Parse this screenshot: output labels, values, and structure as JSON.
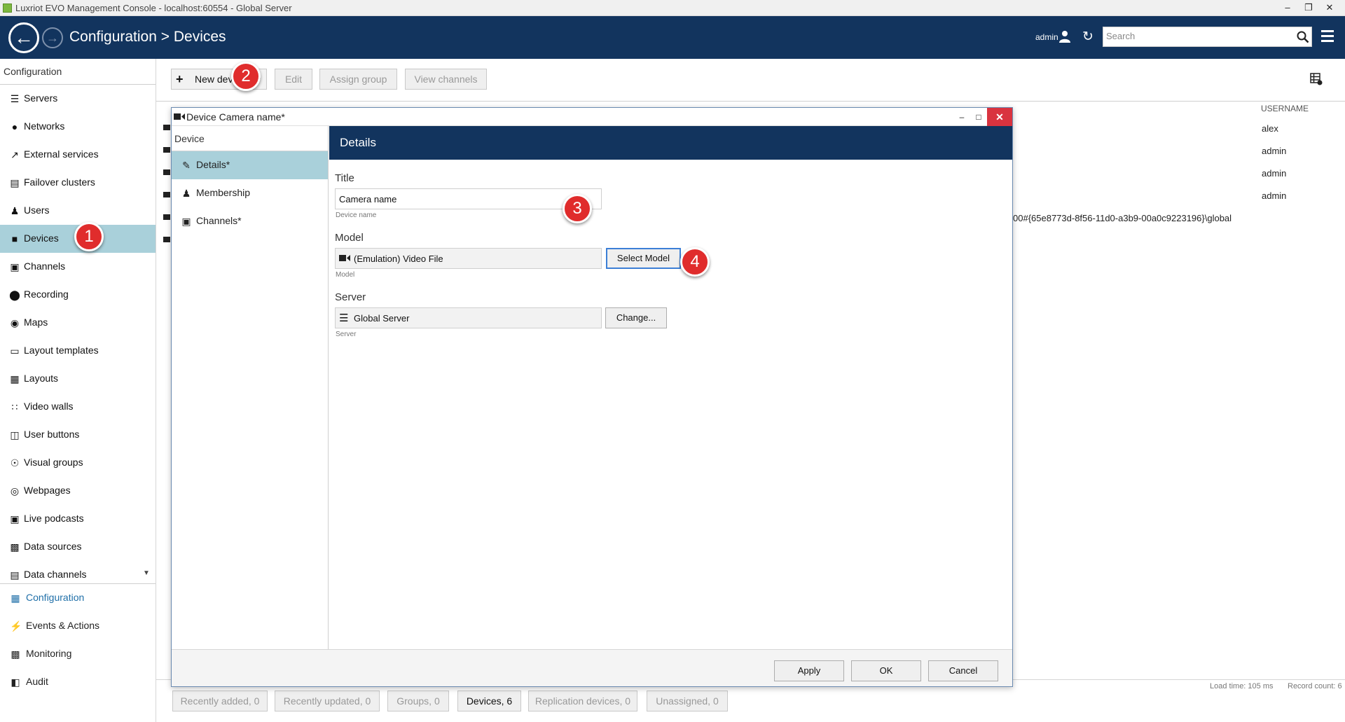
{
  "window": {
    "title": "Luxriot EVO Management Console - localhost:60554 - Global Server",
    "controls": [
      "minimize",
      "restore",
      "close"
    ]
  },
  "header": {
    "breadcrumb": "Configuration > Devices",
    "user": "admin",
    "search_placeholder": "Search"
  },
  "sidebar": {
    "section_title": "Configuration",
    "items": [
      {
        "label": "Servers",
        "icon": "servers-icon"
      },
      {
        "label": "Networks",
        "icon": "globe-icon"
      },
      {
        "label": "External services",
        "icon": "external-icon"
      },
      {
        "label": "Failover clusters",
        "icon": "cluster-icon"
      },
      {
        "label": "Users",
        "icon": "user-icon"
      },
      {
        "label": "Devices",
        "icon": "camera-icon"
      },
      {
        "label": "Channels",
        "icon": "channels-icon"
      },
      {
        "label": "Recording",
        "icon": "record-icon"
      },
      {
        "label": "Maps",
        "icon": "map-icon"
      },
      {
        "label": "Layout templates",
        "icon": "layout-template-icon"
      },
      {
        "label": "Layouts",
        "icon": "layouts-icon"
      },
      {
        "label": "Video walls",
        "icon": "video-wall-icon"
      },
      {
        "label": "User buttons",
        "icon": "user-buttons-icon"
      },
      {
        "label": "Visual groups",
        "icon": "eye-icon"
      },
      {
        "label": "Webpages",
        "icon": "webpage-icon"
      },
      {
        "label": "Live podcasts",
        "icon": "podcast-icon"
      },
      {
        "label": "Data sources",
        "icon": "data-source-icon"
      },
      {
        "label": "Data channels",
        "icon": "data-channel-icon"
      }
    ],
    "bottom_nav": [
      {
        "label": "Configuration",
        "icon": "configuration-icon"
      },
      {
        "label": "Events & Actions",
        "icon": "lightning-icon"
      },
      {
        "label": "Monitoring",
        "icon": "monitoring-icon"
      },
      {
        "label": "Audit",
        "icon": "audit-icon"
      }
    ]
  },
  "toolbar": {
    "new_device": "New devi",
    "edit": "Edit",
    "assign_group": "Assign group",
    "view_channels": "View channels"
  },
  "table": {
    "visible_header": "USERNAME",
    "rows": [
      {
        "username": "alex"
      },
      {
        "username": "admin"
      },
      {
        "username": "admin"
      },
      {
        "username": "admin"
      },
      {
        "url_fragment": "00#{65e8773d-8f56-11d0-a3b9-00a0c9223196}\\global"
      }
    ]
  },
  "status_bar": {
    "tabs": [
      "Recently added, 0",
      "Recently updated, 0",
      "Groups, 0",
      "Devices, 6",
      "Replication devices, 0",
      "Unassigned, 0"
    ],
    "load_time": "Load time: 105 ms",
    "record_count": "Record count: 6"
  },
  "dialog": {
    "title": "Device Camera name*",
    "left_section": "Device",
    "nav": [
      {
        "label": "Details*",
        "icon": "pencil-icon"
      },
      {
        "label": "Membership",
        "icon": "membership-icon"
      },
      {
        "label": "Channels*",
        "icon": "channels-icon"
      }
    ],
    "banner": "Details",
    "title_field": {
      "label": "Title",
      "value": "Camera name",
      "hint": "Device name"
    },
    "model_field": {
      "label": "Model",
      "value": "(Emulation) Video File",
      "hint": "Model",
      "button": "Select Model"
    },
    "server_field": {
      "label": "Server",
      "value": "Global Server",
      "hint": "Server",
      "button": "Change..."
    },
    "buttons": {
      "apply": "Apply",
      "ok": "OK",
      "cancel": "Cancel"
    }
  },
  "callouts": [
    "1",
    "2",
    "3",
    "4"
  ],
  "colors": {
    "header_bg": "#12345e",
    "active_item_bg": "#a9d0da",
    "close_red": "#d9333f",
    "callout_red": "#e02c2c"
  }
}
